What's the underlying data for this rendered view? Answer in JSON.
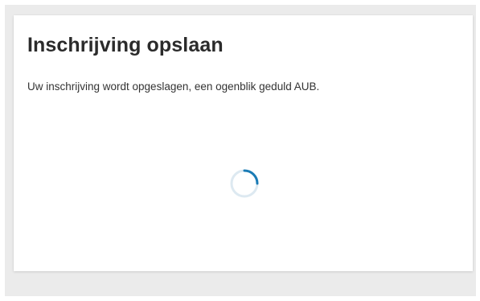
{
  "dialog": {
    "title": "Inschrijving opslaan",
    "message": "Uw inschrijving wordt opgeslagen, een ogenblik geduld AUB."
  },
  "spinner": {
    "icon": "loading-spinner-icon",
    "track_color": "#dde9f1",
    "accent_color": "#1a7bb5"
  },
  "colors": {
    "background": "#ebebeb",
    "card": "#ffffff",
    "title_text": "#2b2b2b",
    "body_text": "#333333"
  }
}
